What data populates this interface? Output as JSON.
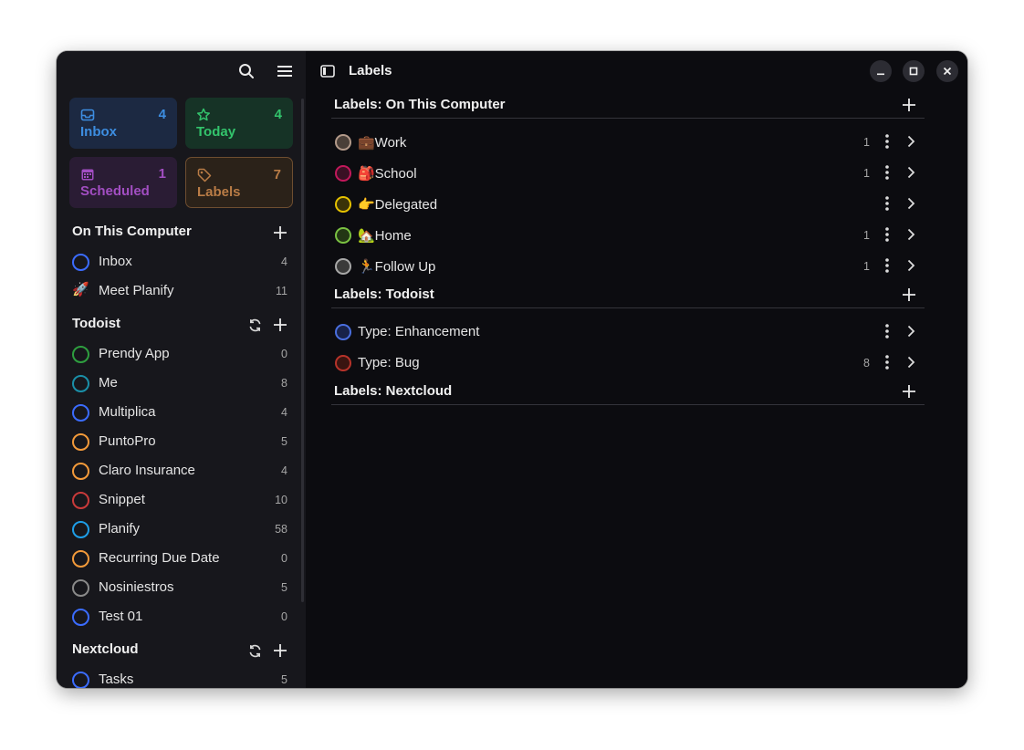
{
  "sidebar": {
    "filters": {
      "inbox": {
        "label": "Inbox",
        "count": "4"
      },
      "today": {
        "label": "Today",
        "count": "4"
      },
      "scheduled": {
        "label": "Scheduled",
        "count": "1"
      },
      "labels": {
        "label": "Labels",
        "count": "7"
      }
    },
    "sections": {
      "local": {
        "title": "On This Computer",
        "projects": [
          {
            "name": "Inbox",
            "count": "4",
            "color": "#3b6cff"
          },
          {
            "name": "Meet Planify",
            "count": "11",
            "emoji": "🚀"
          }
        ]
      },
      "todoist": {
        "title": "Todoist",
        "projects": [
          {
            "name": "Prendy App",
            "count": "0",
            "color": "#2e9e3f"
          },
          {
            "name": "Me",
            "count": "8",
            "color": "#1a8fa8"
          },
          {
            "name": "Multiplica",
            "count": "4",
            "color": "#3b6cff"
          },
          {
            "name": "PuntoPro",
            "count": "5",
            "color": "#f39a3a"
          },
          {
            "name": "Claro Insurance",
            "count": "4",
            "color": "#f39a3a"
          },
          {
            "name": "Snippet",
            "count": "10",
            "color": "#c93a3a"
          },
          {
            "name": "Planify",
            "count": "58",
            "color": "#1e9ee8"
          },
          {
            "name": "Recurring Due Date",
            "count": "0",
            "color": "#f39a3a"
          },
          {
            "name": "Nosiniestros",
            "count": "5",
            "color": "#8a8a8a"
          },
          {
            "name": "Test 01",
            "count": "0",
            "color": "#3b6cff"
          }
        ]
      },
      "nextcloud": {
        "title": "Nextcloud",
        "projects": [
          {
            "name": "Tasks",
            "count": "5",
            "color": "#3b6cff"
          }
        ]
      }
    }
  },
  "main": {
    "title": "Labels",
    "groups": [
      {
        "title": "Labels: On This Computer",
        "labels": [
          {
            "name": "💼Work",
            "count": "1",
            "color": "#b39a8a"
          },
          {
            "name": "🎒School",
            "count": "1",
            "color": "#c2185b"
          },
          {
            "name": "👉Delegated",
            "count": "",
            "color": "#e6c200"
          },
          {
            "name": "🏡Home",
            "count": "1",
            "color": "#7ac142"
          },
          {
            "name": "🏃Follow Up",
            "count": "1",
            "color": "#a8a8a8"
          }
        ]
      },
      {
        "title": "Labels: Todoist",
        "labels": [
          {
            "name": "Type: Enhancement",
            "count": "",
            "color": "#4a6fe0"
          },
          {
            "name": "Type: Bug",
            "count": "8",
            "color": "#b8332a"
          }
        ]
      },
      {
        "title": "Labels: Nextcloud",
        "labels": []
      }
    ]
  }
}
